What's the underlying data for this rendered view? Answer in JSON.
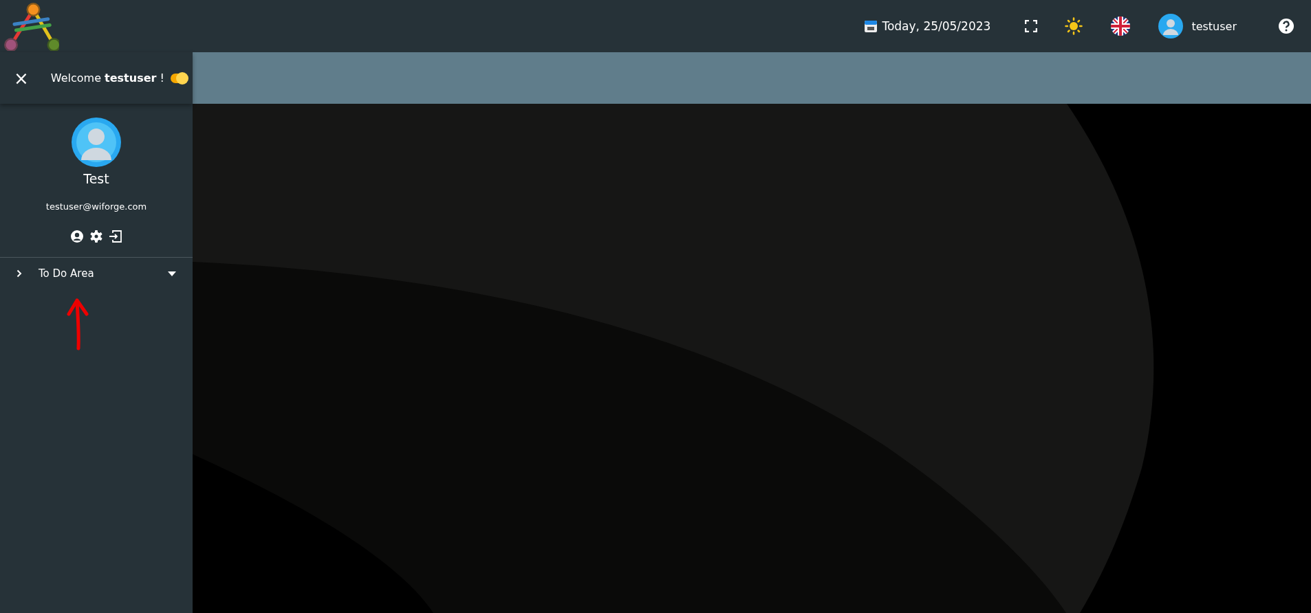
{
  "header": {
    "date": "Today, 25/05/2023",
    "username": "testuser"
  },
  "sidebar": {
    "close": "×",
    "welcome": "Welcome **testuser** !",
    "toggle": {
      "on": true
    },
    "profile_name": "Test",
    "email": "testuser@wiforge.com",
    "menu": [
      {
        "label": "To Do Area",
        "expanded": false
      }
    ]
  }
}
